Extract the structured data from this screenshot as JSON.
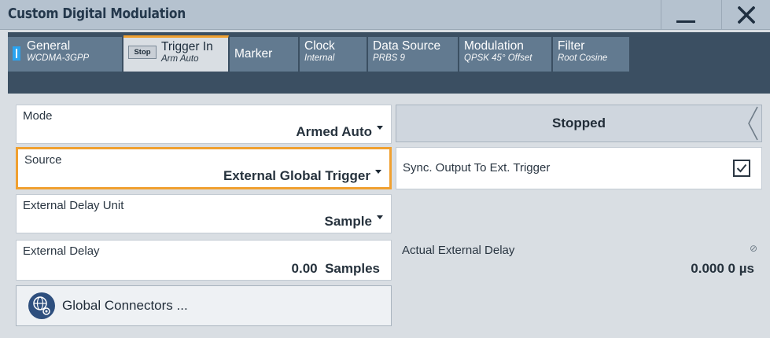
{
  "window": {
    "title": "Custom Digital Modulation",
    "minimize_label": "—",
    "close_label": "✕"
  },
  "tabs": [
    {
      "label": "General",
      "sub": "WCDMA-3GPP",
      "indicator": "on-indicator-icon"
    },
    {
      "label": "Trigger In",
      "sub": "Arm Auto",
      "badge": "Stop",
      "active": true
    },
    {
      "label": "Marker",
      "sub": ""
    },
    {
      "label": "Clock",
      "sub": "Internal"
    },
    {
      "label": "Data Source",
      "sub": "PRBS 9"
    },
    {
      "label": "Modulation",
      "sub": "QPSK 45° Offset"
    },
    {
      "label": "Filter",
      "sub": "Root Cosine"
    }
  ],
  "trigger": {
    "mode": {
      "label": "Mode",
      "value": "Armed Auto"
    },
    "source": {
      "label": "Source",
      "value": "External Global Trigger"
    },
    "delay_unit": {
      "label": "External Delay Unit",
      "value": "Sample"
    },
    "delay": {
      "label": "External Delay",
      "value": "0.00  Samples"
    },
    "status": {
      "label": "Stopped"
    },
    "sync_output": {
      "label": "Sync. Output To Ext. Trigger",
      "checked": true
    },
    "actual_delay": {
      "label": "Actual External Delay",
      "value": "0.000 0 µs"
    },
    "global_connectors": {
      "label": "Global Connectors ...",
      "icon": "globe-gear-icon"
    }
  },
  "colors": {
    "accent": "#f0a030",
    "tab_bar": "#3b4f62",
    "tab_inactive": "#627a90",
    "indicator_blue": "#2aa3f0"
  }
}
